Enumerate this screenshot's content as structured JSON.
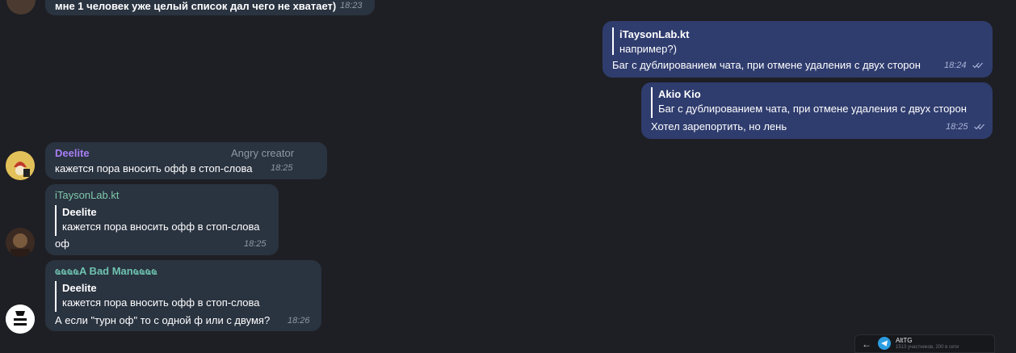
{
  "messages": {
    "m0": {
      "text": "мне 1 человек уже целый список дал чего не хватает)",
      "time": "18:23"
    },
    "m1": {
      "sender": "iTaysonLab.kt",
      "quote_text": "например?)",
      "text": "Баг с дублированием чата, при отмене удаления с двух сторон",
      "time": "18:24"
    },
    "m2": {
      "reply_name": "Akio Kio",
      "reply_text": "Баг с дублированием чата, при отмене удаления с двух сторон",
      "text": "Хотел зарепортить, но лень",
      "time": "18:25"
    },
    "m3": {
      "sender": "Deelite",
      "badge": "Angry creator",
      "text": "кажется пора вносить офф в стоп-слова",
      "time": "18:25"
    },
    "m4": {
      "sender": "iTaysonLab.kt",
      "reply_name": "Deelite",
      "reply_text": "кажется пора вносить офф в стоп-слова",
      "text": "оф",
      "time": "18:25"
    },
    "m5": {
      "sender": "ҩҩҩҩA Bad Manҩҩҩҩ",
      "reply_name": "Deelite",
      "reply_text": "кажется пора вносить офф в стоп-слова",
      "text": "А если \"турн оф\" то с одной ф или с двумя?",
      "time": "18:26"
    }
  },
  "mini_preview": {
    "title": "AltTG",
    "subtitle": "1513 участников, 200 в сети"
  },
  "colors": {
    "background": "#1e1f24",
    "incoming_bubble": "#2a3340",
    "outgoing_bubble": "#2f3c6e",
    "deelite_name": "#a77ef2",
    "itayson_name": "#7ec8a9",
    "badman_name": "#6fc3b0"
  }
}
